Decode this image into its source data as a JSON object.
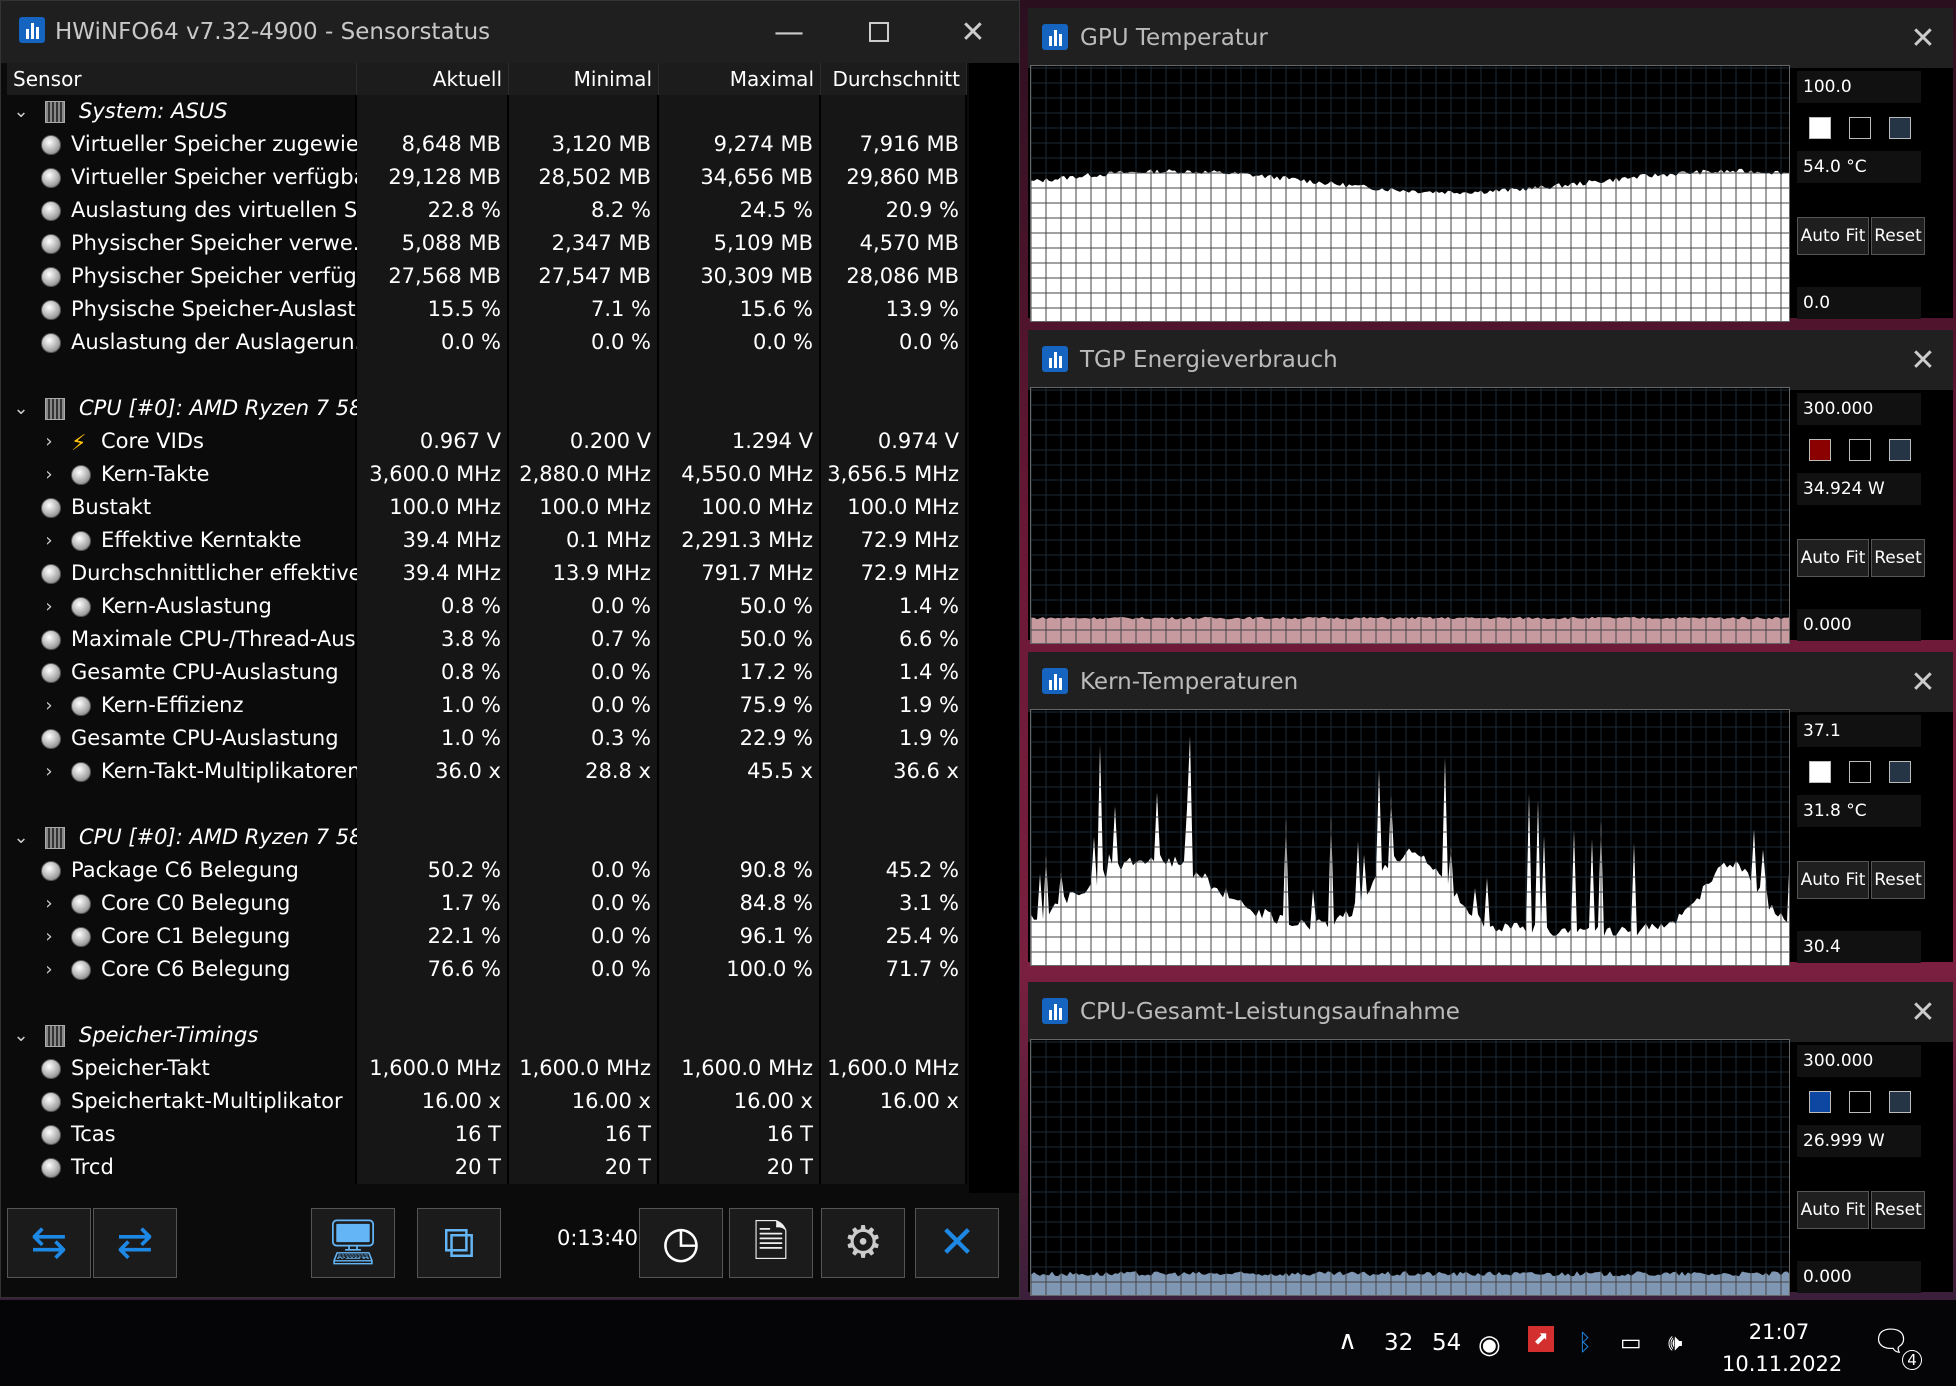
{
  "main_window": {
    "title": "HWiNFO64 v7.32-4900 - Sensorstatus",
    "columns": [
      "Sensor",
      "Aktuell",
      "Minimal",
      "Maximal",
      "Durchschnitt"
    ],
    "timer": "0:13:40"
  },
  "rows": [
    {
      "type": "group",
      "name": "System: ASUS"
    },
    {
      "type": "sensor",
      "indent": 0,
      "icon": "gauge-icon",
      "name": "Virtueller Speicher zugewie...",
      "v": [
        "8,648 MB",
        "3,120 MB",
        "9,274 MB",
        "7,916 MB"
      ]
    },
    {
      "type": "sensor",
      "indent": 0,
      "icon": "gauge-icon",
      "name": "Virtueller Speicher verfügbar",
      "v": [
        "29,128 MB",
        "28,502 MB",
        "34,656 MB",
        "29,860 MB"
      ]
    },
    {
      "type": "sensor",
      "indent": 0,
      "icon": "gauge-icon",
      "name": "Auslastung des virtuellen S...",
      "v": [
        "22.8 %",
        "8.2 %",
        "24.5 %",
        "20.9 %"
      ]
    },
    {
      "type": "sensor",
      "indent": 0,
      "icon": "gauge-icon",
      "name": "Physischer Speicher verwe...",
      "v": [
        "5,088 MB",
        "2,347 MB",
        "5,109 MB",
        "4,570 MB"
      ]
    },
    {
      "type": "sensor",
      "indent": 0,
      "icon": "gauge-icon",
      "name": "Physischer Speicher verfüg...",
      "v": [
        "27,568 MB",
        "27,547 MB",
        "30,309 MB",
        "28,086 MB"
      ]
    },
    {
      "type": "sensor",
      "indent": 0,
      "icon": "gauge-icon",
      "name": "Physische Speicher-Auslast...",
      "v": [
        "15.5 %",
        "7.1 %",
        "15.6 %",
        "13.9 %"
      ]
    },
    {
      "type": "sensor",
      "indent": 0,
      "icon": "gauge-icon",
      "name": "Auslastung der Auslagerun...",
      "v": [
        "0.0 %",
        "0.0 %",
        "0.0 %",
        "0.0 %"
      ]
    },
    {
      "type": "blank"
    },
    {
      "type": "group",
      "name": "CPU [#0]: AMD Ryzen 7 58..."
    },
    {
      "type": "sensor",
      "indent": 1,
      "icon": "bolt-icon",
      "name": "Core VIDs",
      "v": [
        "0.967 V",
        "0.200 V",
        "1.294 V",
        "0.974 V"
      ]
    },
    {
      "type": "sensor",
      "indent": 1,
      "icon": "gauge-icon",
      "name": "Kern-Takte",
      "v": [
        "3,600.0 MHz",
        "2,880.0 MHz",
        "4,550.0 MHz",
        "3,656.5 MHz"
      ]
    },
    {
      "type": "sensor",
      "indent": 0,
      "icon": "gauge-icon",
      "name": "Bustakt",
      "v": [
        "100.0 MHz",
        "100.0 MHz",
        "100.0 MHz",
        "100.0 MHz"
      ]
    },
    {
      "type": "sensor",
      "indent": 1,
      "icon": "gauge-icon",
      "name": "Effektive Kerntakte",
      "v": [
        "39.4 MHz",
        "0.1 MHz",
        "2,291.3 MHz",
        "72.9 MHz"
      ]
    },
    {
      "type": "sensor",
      "indent": 0,
      "icon": "gauge-icon",
      "name": "Durchschnittlicher effektive...",
      "v": [
        "39.4 MHz",
        "13.9 MHz",
        "791.7 MHz",
        "72.9 MHz"
      ]
    },
    {
      "type": "sensor",
      "indent": 1,
      "icon": "gauge-icon",
      "name": "Kern-Auslastung",
      "v": [
        "0.8 %",
        "0.0 %",
        "50.0 %",
        "1.4 %"
      ]
    },
    {
      "type": "sensor",
      "indent": 0,
      "icon": "gauge-icon",
      "name": "Maximale CPU-/Thread-Aus...",
      "v": [
        "3.8 %",
        "0.7 %",
        "50.0 %",
        "6.6 %"
      ]
    },
    {
      "type": "sensor",
      "indent": 0,
      "icon": "gauge-icon",
      "name": "Gesamte CPU-Auslastung",
      "v": [
        "0.8 %",
        "0.0 %",
        "17.2 %",
        "1.4 %"
      ]
    },
    {
      "type": "sensor",
      "indent": 1,
      "icon": "gauge-icon",
      "name": "Kern-Effizienz",
      "v": [
        "1.0 %",
        "0.0 %",
        "75.9 %",
        "1.9 %"
      ]
    },
    {
      "type": "sensor",
      "indent": 0,
      "icon": "gauge-icon",
      "name": "Gesamte CPU-Auslastung",
      "v": [
        "1.0 %",
        "0.3 %",
        "22.9 %",
        "1.9 %"
      ]
    },
    {
      "type": "sensor",
      "indent": 1,
      "icon": "gauge-icon",
      "name": "Kern-Takt-Multiplikatoren",
      "v": [
        "36.0 x",
        "28.8 x",
        "45.5 x",
        "36.6 x"
      ]
    },
    {
      "type": "blank"
    },
    {
      "type": "group",
      "name": "CPU [#0]: AMD Ryzen 7 58..."
    },
    {
      "type": "sensor",
      "indent": 0,
      "icon": "gauge-icon",
      "name": "Package C6 Belegung",
      "v": [
        "50.2 %",
        "0.0 %",
        "90.8 %",
        "45.2 %"
      ]
    },
    {
      "type": "sensor",
      "indent": 1,
      "icon": "gauge-icon",
      "name": "Core C0 Belegung",
      "v": [
        "1.7 %",
        "0.0 %",
        "84.8 %",
        "3.1 %"
      ]
    },
    {
      "type": "sensor",
      "indent": 1,
      "icon": "gauge-icon",
      "name": "Core C1 Belegung",
      "v": [
        "22.1 %",
        "0.0 %",
        "96.1 %",
        "25.4 %"
      ]
    },
    {
      "type": "sensor",
      "indent": 1,
      "icon": "gauge-icon",
      "name": "Core C6 Belegung",
      "v": [
        "76.6 %",
        "0.0 %",
        "100.0 %",
        "71.7 %"
      ]
    },
    {
      "type": "blank"
    },
    {
      "type": "group",
      "name": "Speicher-Timings"
    },
    {
      "type": "sensor",
      "indent": 0,
      "icon": "gauge-icon",
      "name": "Speicher-Takt",
      "v": [
        "1,600.0 MHz",
        "1,600.0 MHz",
        "1,600.0 MHz",
        "1,600.0 MHz"
      ]
    },
    {
      "type": "sensor",
      "indent": 0,
      "icon": "gauge-icon",
      "name": "Speichertakt-Multiplikator",
      "v": [
        "16.00 x",
        "16.00 x",
        "16.00 x",
        "16.00 x"
      ]
    },
    {
      "type": "sensor",
      "indent": 0,
      "icon": "gauge-icon",
      "name": "Tcas",
      "v": [
        "16 T",
        "16 T",
        "16 T",
        ""
      ]
    },
    {
      "type": "sensor",
      "indent": 0,
      "icon": "gauge-icon",
      "name": "Trcd",
      "v": [
        "20 T",
        "20 T",
        "20 T",
        ""
      ]
    }
  ],
  "toolbar_icons": [
    "expand-arrows-icon",
    "collapse-arrows-icon",
    "monitor-search-icon",
    "network-computers-icon",
    "clock-icon",
    "add-log-icon",
    "settings-gear-icon",
    "close-x-icon"
  ],
  "graphs": [
    {
      "title": "GPU Temperatur",
      "max": "100.0",
      "current": "54.0 °C",
      "min": "0.0",
      "swatch": "#ffffff",
      "auto_fit": "Auto Fit",
      "reset": "Reset",
      "fill": "#ffffff",
      "level": 0.55,
      "noise": 0.02,
      "style": "smooth"
    },
    {
      "title": "TGP Energieverbrauch",
      "max": "300.000",
      "current": "34.924 W",
      "min": "0.000",
      "swatch": "#8b0000",
      "auto_fit": "Auto Fit",
      "reset": "Reset",
      "fill": "#c79a9f",
      "level": 0.105,
      "noise": 0.005,
      "style": "flat"
    },
    {
      "title": "Kern-Temperaturen",
      "max": "37.1",
      "current": "31.8 °C",
      "min": "30.4",
      "swatch": "#ffffff",
      "auto_fit": "Auto Fit",
      "reset": "Reset",
      "fill": "#ffffff",
      "level": 0.3,
      "noise": 0.2,
      "style": "spiky"
    },
    {
      "title": "CPU-Gesamt-Leistungsaufnahme",
      "max": "300.000",
      "current": "26.999 W",
      "min": "0.000",
      "swatch": "#0d47a1",
      "auto_fit": "Auto Fit",
      "reset": "Reset",
      "fill": "#7f97b3",
      "level": 0.09,
      "noise": 0.01,
      "style": "flat"
    }
  ],
  "taskbar": {
    "tray_num1": "32",
    "tray_num2": "54",
    "time": "21:07",
    "date": "10.11.2022",
    "notif_count": "4"
  }
}
